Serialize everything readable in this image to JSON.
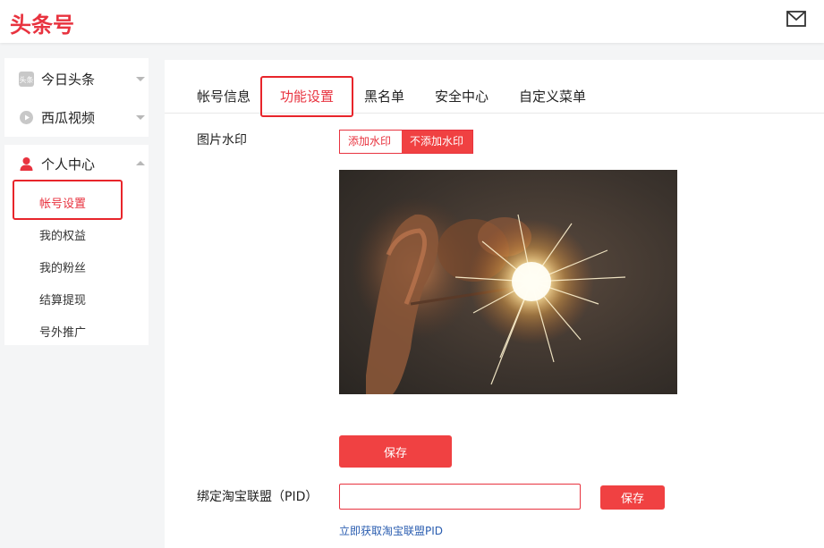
{
  "header": {
    "logo_text": "头条号",
    "mail_icon": "mail-icon"
  },
  "sidebar": {
    "top_items": [
      {
        "label": "今日头条",
        "icon": "toutiao-icon"
      },
      {
        "label": "西瓜视频",
        "icon": "xigua-play-icon"
      }
    ],
    "personal_center": {
      "label": "个人中心",
      "icon": "user-icon",
      "expanded": true,
      "sub_items": [
        {
          "label": "帐号设置",
          "active": true
        },
        {
          "label": "我的权益"
        },
        {
          "label": "我的粉丝"
        },
        {
          "label": "结算提现"
        },
        {
          "label": "号外推广"
        }
      ]
    }
  },
  "tabs": [
    {
      "label": "帐号信息"
    },
    {
      "label": "功能设置",
      "active": true
    },
    {
      "label": "黑名单"
    },
    {
      "label": "安全中心"
    },
    {
      "label": "自定义菜单"
    }
  ],
  "watermark": {
    "label": "图片水印",
    "options": [
      "添加水印",
      "不添加水印"
    ],
    "selected": "不添加水印",
    "save_label": "保存"
  },
  "taobao": {
    "label": "绑定淘宝联盟（PID）",
    "input_value": "",
    "save_label": "保存",
    "link_text": "立即获取淘宝联盟PID"
  },
  "colors": {
    "accent": "#f04142",
    "highlight": "#e8252b",
    "link": "#2a5db0"
  }
}
